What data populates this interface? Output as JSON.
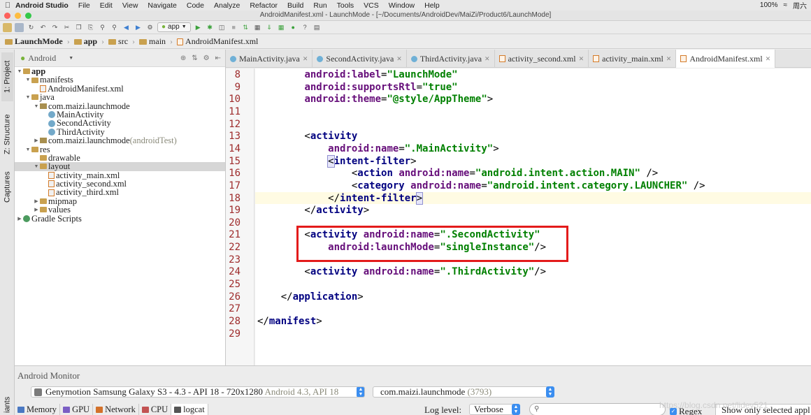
{
  "menubar": {
    "apple": "",
    "app_name": "Android Studio",
    "items": [
      "File",
      "Edit",
      "View",
      "Navigate",
      "Code",
      "Analyze",
      "Refactor",
      "Build",
      "Run",
      "Tools",
      "VCS",
      "Window",
      "Help"
    ],
    "battery": "100%",
    "clock": "周六"
  },
  "window": {
    "title": "AndroidManifest.xml - LaunchMode - [~/Documents/AndroidDev/MaiZi/Product6/LaunchMode]"
  },
  "toolbar": {
    "run_config": "app"
  },
  "breadcrumbs": [
    "LaunchMode",
    "app",
    "src",
    "main",
    "AndroidManifest.xml"
  ],
  "side_tabs": {
    "project": "1: Project",
    "structure": "Z: Structure",
    "captures": "Captures",
    "variants": "iants"
  },
  "project_panel": {
    "view_mode": "Android",
    "tree": [
      {
        "label": "app",
        "depth": 0,
        "icon": "folder",
        "expanded": true,
        "bold": true
      },
      {
        "label": "manifests",
        "depth": 1,
        "icon": "folder",
        "expanded": true
      },
      {
        "label": "AndroidManifest.xml",
        "depth": 2,
        "icon": "xml"
      },
      {
        "label": "java",
        "depth": 1,
        "icon": "folder",
        "expanded": true
      },
      {
        "label": "com.maizi.launchmode",
        "depth": 2,
        "icon": "package",
        "expanded": true
      },
      {
        "label": "MainActivity",
        "depth": 3,
        "icon": "class"
      },
      {
        "label": "SecondActivity",
        "depth": 3,
        "icon": "class"
      },
      {
        "label": "ThirdActivity",
        "depth": 3,
        "icon": "class"
      },
      {
        "label": "com.maizi.launchmode",
        "suffix": " (androidTest)",
        "depth": 2,
        "icon": "package",
        "collapsed": true
      },
      {
        "label": "res",
        "depth": 1,
        "icon": "folder",
        "expanded": true
      },
      {
        "label": "drawable",
        "depth": 2,
        "icon": "folder"
      },
      {
        "label": "layout",
        "depth": 2,
        "icon": "folder",
        "expanded": true,
        "selected": true
      },
      {
        "label": "activity_main.xml",
        "depth": 3,
        "icon": "xml"
      },
      {
        "label": "activity_second.xml",
        "depth": 3,
        "icon": "xml"
      },
      {
        "label": "activity_third.xml",
        "depth": 3,
        "icon": "xml"
      },
      {
        "label": "mipmap",
        "depth": 2,
        "icon": "folder",
        "collapsed": true
      },
      {
        "label": "values",
        "depth": 2,
        "icon": "folder",
        "collapsed": true
      },
      {
        "label": "Gradle Scripts",
        "depth": 0,
        "icon": "gradle",
        "collapsed": true
      }
    ]
  },
  "editor_tabs": [
    {
      "label": "MainActivity.java",
      "kind": "java"
    },
    {
      "label": "SecondActivity.java",
      "kind": "java"
    },
    {
      "label": "ThirdActivity.java",
      "kind": "java"
    },
    {
      "label": "activity_second.xml",
      "kind": "xml"
    },
    {
      "label": "activity_main.xml",
      "kind": "xml"
    },
    {
      "label": "AndroidManifest.xml",
      "kind": "xml",
      "active": true
    }
  ],
  "editor": {
    "current_line": 18,
    "lines": [
      {
        "n": "8",
        "tokens": [
          [
            "",
            "        "
          ],
          [
            "attr",
            "android:label"
          ],
          [
            "",
            "="
          ],
          [
            "val",
            "\"LaunchMode\""
          ]
        ]
      },
      {
        "n": "9",
        "tokens": [
          [
            "",
            "        "
          ],
          [
            "attr",
            "android:supportsRtl"
          ],
          [
            "",
            "="
          ],
          [
            "val",
            "\"true\""
          ]
        ]
      },
      {
        "n": "10",
        "tokens": [
          [
            "",
            "        "
          ],
          [
            "attr",
            "android:theme"
          ],
          [
            "",
            "="
          ],
          [
            "val",
            "\"@style/AppTheme\""
          ],
          [
            "",
            ">"
          ]
        ]
      },
      {
        "n": "11",
        "tokens": []
      },
      {
        "n": "12",
        "tokens": []
      },
      {
        "n": "13",
        "tokens": [
          [
            "",
            "        <"
          ],
          [
            "tag",
            "activity"
          ]
        ]
      },
      {
        "n": "14",
        "tokens": [
          [
            "",
            "            "
          ],
          [
            "attr",
            "android:name"
          ],
          [
            "",
            "="
          ],
          [
            "val",
            "\".MainActivity\""
          ],
          [
            "",
            ">"
          ]
        ]
      },
      {
        "n": "15",
        "tokens": [
          [
            "",
            "            "
          ],
          [
            "hl",
            "<"
          ],
          [
            "tag",
            "intent-filter"
          ],
          [
            "",
            ">"
          ]
        ]
      },
      {
        "n": "16",
        "tokens": [
          [
            "",
            "                <"
          ],
          [
            "tag",
            "action "
          ],
          [
            "attr",
            "android:name"
          ],
          [
            "",
            "="
          ],
          [
            "val",
            "\"android.intent.action.MAIN\""
          ],
          [
            "",
            " />"
          ]
        ]
      },
      {
        "n": "17",
        "tokens": [
          [
            "",
            "                <"
          ],
          [
            "tag",
            "category "
          ],
          [
            "attr",
            "android:name"
          ],
          [
            "",
            "="
          ],
          [
            "val",
            "\"android.intent.category.LAUNCHER\""
          ],
          [
            "",
            " />"
          ]
        ]
      },
      {
        "n": "18",
        "tokens": [
          [
            "",
            "            </"
          ],
          [
            "tag",
            "intent-filter"
          ],
          [
            "hl",
            ">"
          ]
        ]
      },
      {
        "n": "19",
        "tokens": [
          [
            "",
            "        </"
          ],
          [
            "tag",
            "activity"
          ],
          [
            "",
            ">"
          ]
        ]
      },
      {
        "n": "20",
        "tokens": []
      },
      {
        "n": "21",
        "tokens": [
          [
            "",
            "        <"
          ],
          [
            "tag",
            "activity "
          ],
          [
            "attr",
            "android:name"
          ],
          [
            "",
            "="
          ],
          [
            "val",
            "\".SecondActivity\""
          ]
        ]
      },
      {
        "n": "22",
        "tokens": [
          [
            "",
            "            "
          ],
          [
            "attr",
            "android:launchMode"
          ],
          [
            "",
            "="
          ],
          [
            "val",
            "\"singleInstance\""
          ],
          [
            "",
            "/>"
          ]
        ]
      },
      {
        "n": "23",
        "tokens": []
      },
      {
        "n": "24",
        "tokens": [
          [
            "",
            "        <"
          ],
          [
            "tag",
            "activity "
          ],
          [
            "attr",
            "android:name"
          ],
          [
            "",
            "="
          ],
          [
            "val",
            "\".ThirdActivity\""
          ],
          [
            "",
            "/>"
          ]
        ]
      },
      {
        "n": "25",
        "tokens": []
      },
      {
        "n": "26",
        "tokens": [
          [
            "",
            "    </"
          ],
          [
            "tag",
            "application"
          ],
          [
            "",
            ">"
          ]
        ]
      },
      {
        "n": "27",
        "tokens": []
      },
      {
        "n": "28",
        "tokens": [
          [
            "",
            "</"
          ],
          [
            "tag",
            "manifest"
          ],
          [
            "",
            ">"
          ]
        ]
      },
      {
        "n": "29",
        "tokens": []
      }
    ]
  },
  "monitor": {
    "title": "Android Monitor",
    "device": "Genymotion Samsung Galaxy S3 - 4.3 - API 18 - 720x1280",
    "device_suffix": " Android 4.3, API 18",
    "process": "com.maizi.launchmode",
    "process_suffix": " (3793)",
    "tabs": [
      "Memory",
      "GPU",
      "Network",
      "CPU",
      "logcat"
    ],
    "log_level_label": "Log level:",
    "log_level": "Verbose",
    "search_placeholder": "",
    "regex_label": "Regex",
    "filter": "Show only selected appl",
    "watermark": "https://blog.csdn.net/lidev521"
  }
}
